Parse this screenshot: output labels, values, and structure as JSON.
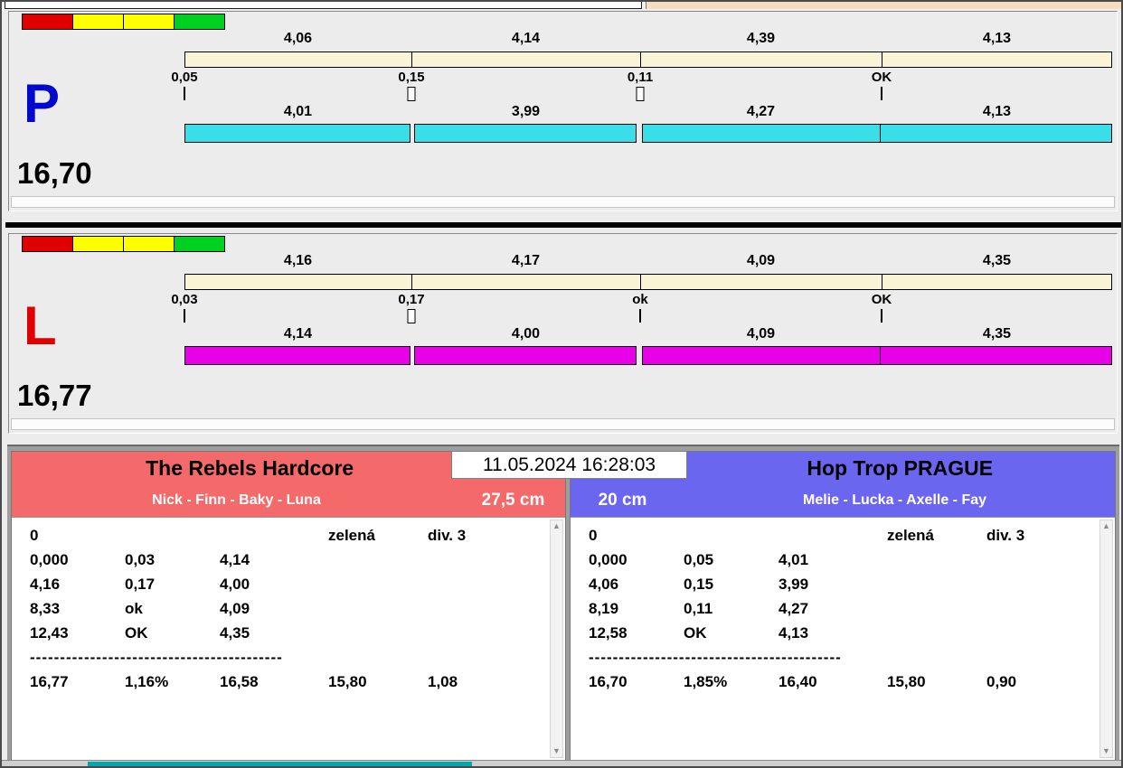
{
  "lanes": [
    {
      "letter": "P",
      "total": "16,70",
      "splits_top": [
        "4,06",
        "4,14",
        "4,39",
        "4,13"
      ],
      "gates": [
        "0,05",
        "0,15",
        "0,11",
        "OK"
      ],
      "gate_marks": [
        "line",
        "box",
        "box",
        "line"
      ],
      "splits_bottom": [
        "4,01",
        "3,99",
        "4,27",
        "4,13"
      ]
    },
    {
      "letter": "L",
      "total": "16,77",
      "splits_top": [
        "4,16",
        "4,17",
        "4,09",
        "4,35"
      ],
      "gates": [
        "0,03",
        "0,17",
        "ok",
        "OK"
      ],
      "gate_marks": [
        "line",
        "box",
        "line",
        "line"
      ],
      "splits_bottom": [
        "4,14",
        "4,00",
        "4,09",
        "4,35"
      ]
    }
  ],
  "clock": {
    "datetime": "11.05.2024 16:28:03"
  },
  "teams": [
    {
      "name": "The Rebels Hardcore",
      "members": "Nick - Finn - Baky - Luna",
      "height": "27,5 cm",
      "info_row": {
        "c0": "0",
        "c3": "zelená",
        "c4": "div. 3"
      },
      "rows": [
        [
          "0,000",
          "0,03",
          "4,14"
        ],
        [
          "4,16",
          "0,17",
          "4,00"
        ],
        [
          "8,33",
          "ok",
          "4,09"
        ],
        [
          "12,43",
          "OK",
          "4,35"
        ]
      ],
      "separator": "------------------------------------------",
      "totals": [
        "16,77",
        "1,16%",
        "16,58",
        "15,80",
        "1,08"
      ]
    },
    {
      "name": "Hop Trop PRAGUE",
      "members": "Melie - Lucka - Axelle - Fay",
      "height": "20 cm",
      "info_row": {
        "c0": "0",
        "c3": "zelená",
        "c4": "div. 3"
      },
      "rows": [
        [
          "0,000",
          "0,05",
          "4,01"
        ],
        [
          "4,06",
          "0,15",
          "3,99"
        ],
        [
          "8,19",
          "0,11",
          "4,27"
        ],
        [
          "12,58",
          "OK",
          "4,13"
        ]
      ],
      "separator": "------------------------------------------",
      "totals": [
        "16,70",
        "1,85%",
        "16,40",
        "15,80",
        "0,90"
      ]
    }
  ],
  "colors": {
    "lane_p_letter": "#0008cc",
    "lane_l_letter": "#e00000",
    "split_bar_top": "#f8f4d5",
    "lane_p_bar": "#3adee8",
    "lane_l_bar": "#e800e8",
    "team_left_header": "#f4696a",
    "team_right_header": "#6b66ef",
    "light_red": "#e00000",
    "light_yellow": "#ffff00",
    "light_green": "#00d020",
    "progress_teal": "#00a8ad"
  }
}
